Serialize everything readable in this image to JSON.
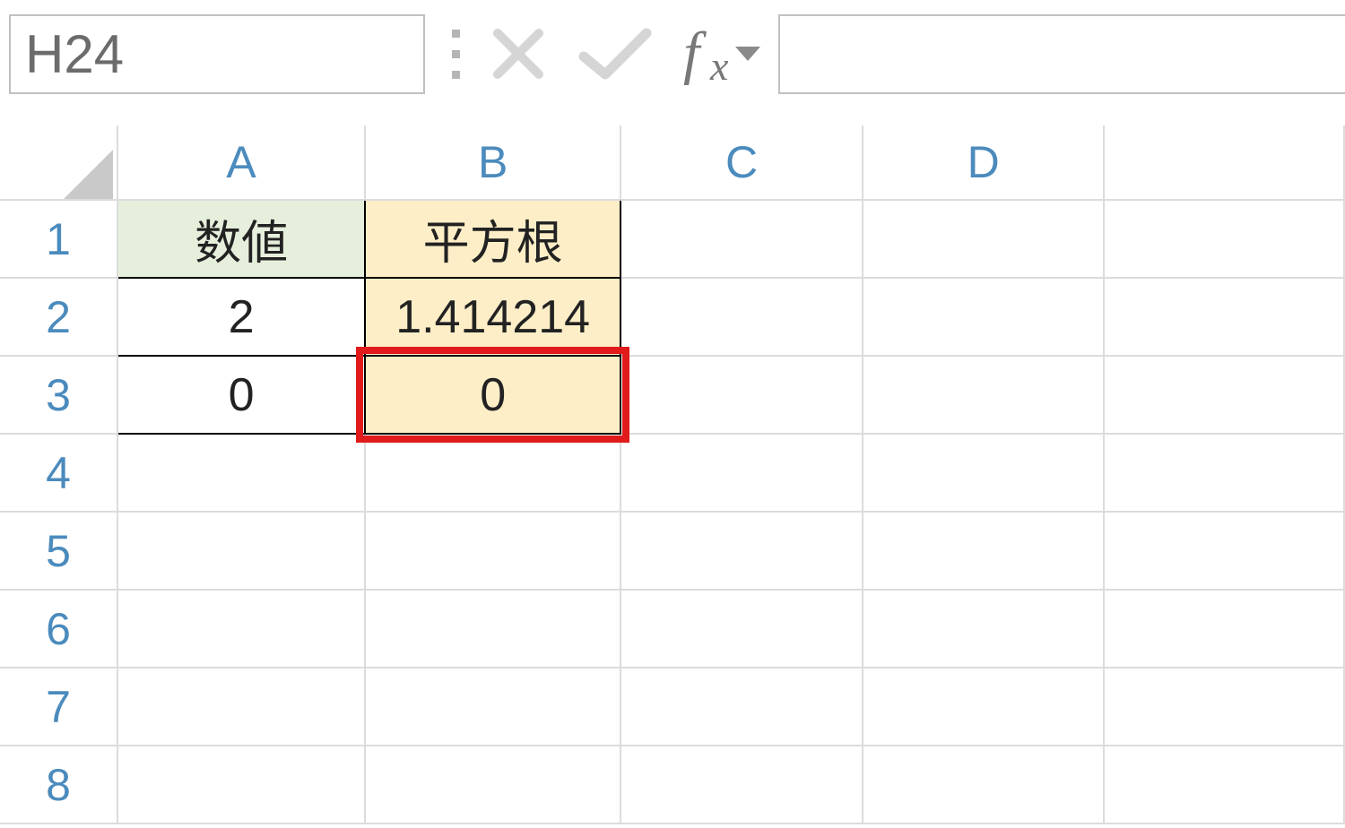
{
  "formulaBar": {
    "nameBoxValue": "H24",
    "formulaValue": ""
  },
  "columns": [
    "A",
    "B",
    "C",
    "D"
  ],
  "rows": [
    "1",
    "2",
    "3",
    "4",
    "5",
    "6",
    "7",
    "8"
  ],
  "cells": {
    "A1": "数値",
    "B1": "平方根",
    "A2": "2",
    "B2": "1.414214",
    "A3": "0",
    "B3": "0"
  },
  "highlight": {
    "cell": "B3"
  },
  "colors": {
    "headerGreen": "#e6efdc",
    "headerYellow": "#fdeec7",
    "redBox": "#e11b1b",
    "colHeaderText": "#4b8bbd"
  }
}
